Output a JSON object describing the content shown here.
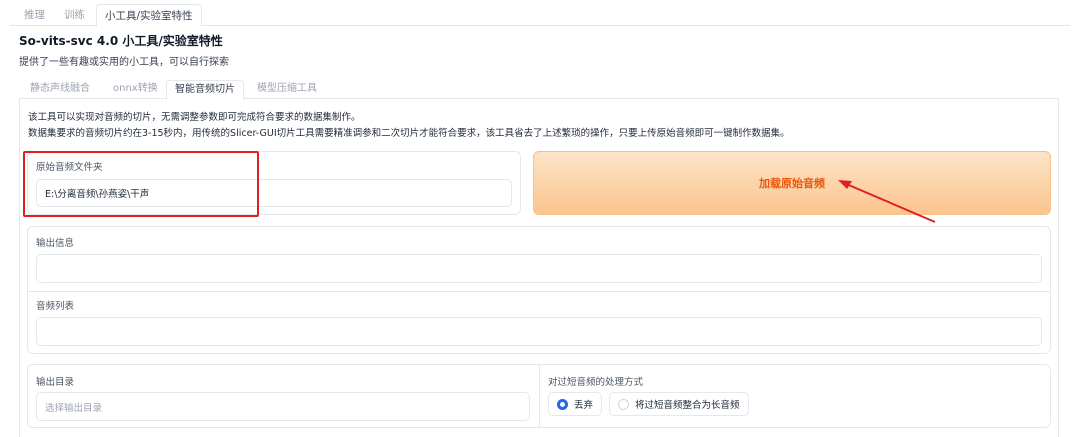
{
  "top_tabs": [
    "推理",
    "训练",
    "小工具/实验室特性"
  ],
  "page": {
    "title": "So-vits-svc 4.0 小工具/实验室特性",
    "description": "提供了一些有趣或实用的小工具，可以自行探索"
  },
  "sub_tabs": [
    "静态声线融合",
    "onnx转换",
    "智能音频切片",
    "模型压缩工具"
  ],
  "slicer": {
    "desc_line1": "该工具可以实现对音频的切片，无需调整参数即可完成符合要求的数据集制作。",
    "desc_line2": "数据集要求的音频切片约在3-15秒内，用传统的Slicer-GUI切片工具需要精准调参和二次切片才能符合要求，该工具省去了上述繁琐的操作，只要上传原始音频即可一键制作数据集。",
    "source_folder_label": "原始音频文件夹",
    "source_folder_value": "E:\\分离音频\\孙燕姿\\干声",
    "load_button": "加载原始音频",
    "output_info_label": "输出信息",
    "output_info_value": "",
    "audio_list_label": "音频列表",
    "audio_list_value": "",
    "output_dir_label": "输出目录",
    "output_dir_placeholder": "选择输出目录",
    "short_audio_label": "对过短音频的处理方式",
    "short_audio_options": [
      "丢弃",
      "将过短音频整合为长音频"
    ],
    "short_audio_selected": "丢弃"
  },
  "colors": {
    "highlight_box": "#e02020",
    "annotation_arrow": "#e02020",
    "button_text": "#ea580c",
    "radio_accent": "#2563eb"
  }
}
